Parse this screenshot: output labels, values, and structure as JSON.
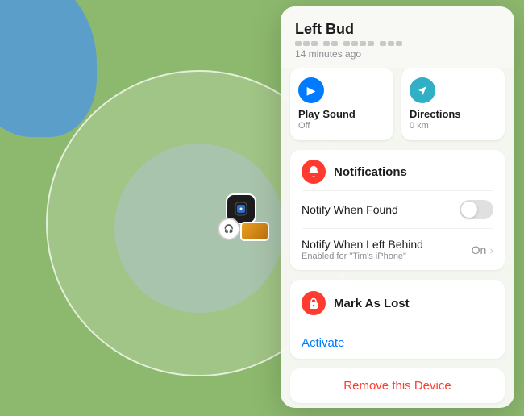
{
  "map": {
    "background_color": "#8db96e"
  },
  "panel": {
    "device_name": "Left Bud",
    "last_seen": "14 minutes ago",
    "actions": [
      {
        "id": "play-sound",
        "label": "Play Sound",
        "sublabel": "Off",
        "icon": "▶",
        "icon_color": "blue"
      },
      {
        "id": "directions",
        "label": "Directions",
        "sublabel": "0 km",
        "icon": "↗",
        "icon_color": "teal"
      }
    ],
    "notifications": {
      "section_title": "Notifications",
      "rows": [
        {
          "id": "notify-found",
          "label": "Notify When Found",
          "has_toggle": true,
          "toggle_on": false
        },
        {
          "id": "notify-left-behind",
          "label": "Notify When Left Behind",
          "sublabel": "Enabled for \"Tim's iPhone\"",
          "value": "On",
          "has_chevron": true
        }
      ]
    },
    "mark_as_lost": {
      "section_title": "Mark As Lost",
      "activate_label": "Activate"
    },
    "remove_device_label": "Remove this Device"
  }
}
